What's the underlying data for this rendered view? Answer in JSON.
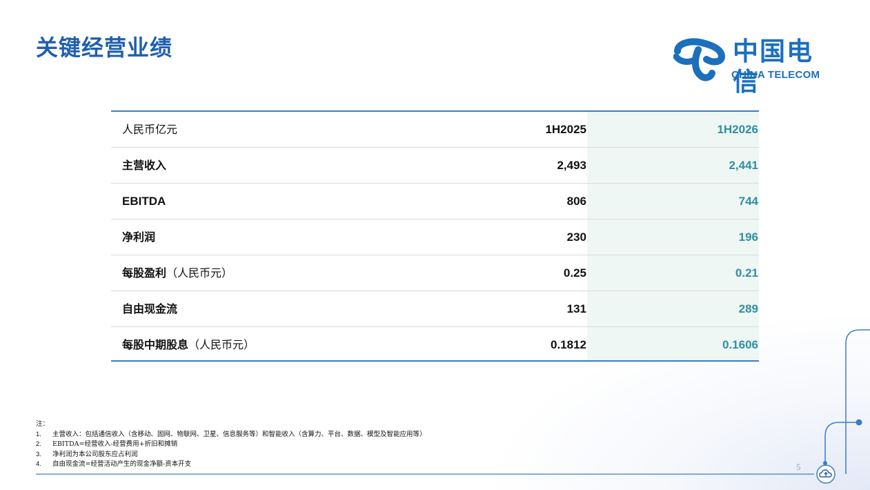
{
  "slide": {
    "title": "关键经营业绩",
    "page_number": "5"
  },
  "logo": {
    "cn": "中国电信",
    "en": "CHINA TELECOM"
  },
  "table": {
    "header": {
      "label": "人民币亿元",
      "prev": "1H2025",
      "cur": "1H2026"
    },
    "rows": [
      {
        "label": "主营收入",
        "prev": "2,493",
        "cur": "2,441"
      },
      {
        "label": "EBITDA",
        "prev": "806",
        "cur": "744"
      },
      {
        "label": "净利润",
        "prev": "230",
        "cur": "196"
      },
      {
        "label": "每股盈利",
        "label_suffix": "（人民币元）",
        "prev": "0.25",
        "cur": "0.21"
      },
      {
        "label": "自由现金流",
        "prev": "131",
        "cur": "289"
      },
      {
        "label": "每股中期股息",
        "label_suffix": "（人民币元）",
        "prev": "0.1812",
        "cur": "0.1606"
      }
    ],
    "colors": {
      "border": "#3b7cc6",
      "highlight_bg": "#eef7f4",
      "highlight_text": "#2f8fa3"
    }
  },
  "notes": {
    "heading": "注：",
    "items": [
      {
        "num": "1.",
        "text": "主营收入：包括通信收入（含移动、固网、物联网、卫星、信息服务等）和智能收入（含算力、平台、数据、模型及智能应用等）"
      },
      {
        "num": "2.",
        "text": "EBITDA=经营收入-经营费用+折旧和摊销"
      },
      {
        "num": "3.",
        "text": "净利润为本公司股东应占利润"
      },
      {
        "num": "4.",
        "text": "自由现金流=经营活动产生的现金净额-资本开支"
      }
    ]
  },
  "colors": {
    "title": "#1f5fae",
    "brand": "#1b6fbd"
  },
  "icons": {
    "corner": "cloud-upload-icon"
  }
}
